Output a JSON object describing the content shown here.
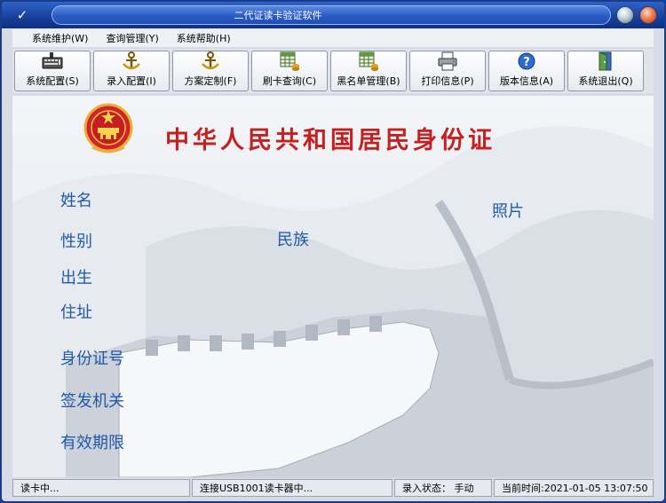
{
  "window": {
    "title": "二代证读卡验证软件"
  },
  "menu": [
    {
      "label": "系统维护(W)"
    },
    {
      "label": "查询管理(Y)"
    },
    {
      "label": "系统帮助(H)"
    }
  ],
  "toolbar": [
    {
      "label": "系统配置(S)",
      "icon": "keyboard-icon"
    },
    {
      "label": "录入配置(I)",
      "icon": "anchor-icon"
    },
    {
      "label": "方案定制(F)",
      "icon": "anchor-icon"
    },
    {
      "label": "刷卡查询(C)",
      "icon": "grid-database-icon"
    },
    {
      "label": "黑名单管理(B)",
      "icon": "grid-database-icon"
    },
    {
      "label": "打印信息(P)",
      "icon": "printer-icon"
    },
    {
      "label": "版本信息(A)",
      "icon": "help-icon"
    },
    {
      "label": "系统退出(Q)",
      "icon": "exit-door-icon"
    }
  ],
  "card": {
    "title": "中华人民共和国居民身份证",
    "labels": {
      "name": "姓名",
      "sex": "性别",
      "ethnicity": "民族",
      "birth": "出生",
      "address": "住址",
      "id_number": "身份证号",
      "authority": "签发机关",
      "validity": "有效期限",
      "photo": "照片"
    }
  },
  "status": {
    "reading": "读卡中...",
    "connection": "连接USB1001读卡器中...",
    "input_mode": "录入状态： 手动",
    "time": "当前时间:2021-01-05 13:07:50"
  },
  "colors": {
    "title_bar": "#17409b",
    "card_title": "#c51f1f",
    "field_label": "#1f5aa8"
  }
}
